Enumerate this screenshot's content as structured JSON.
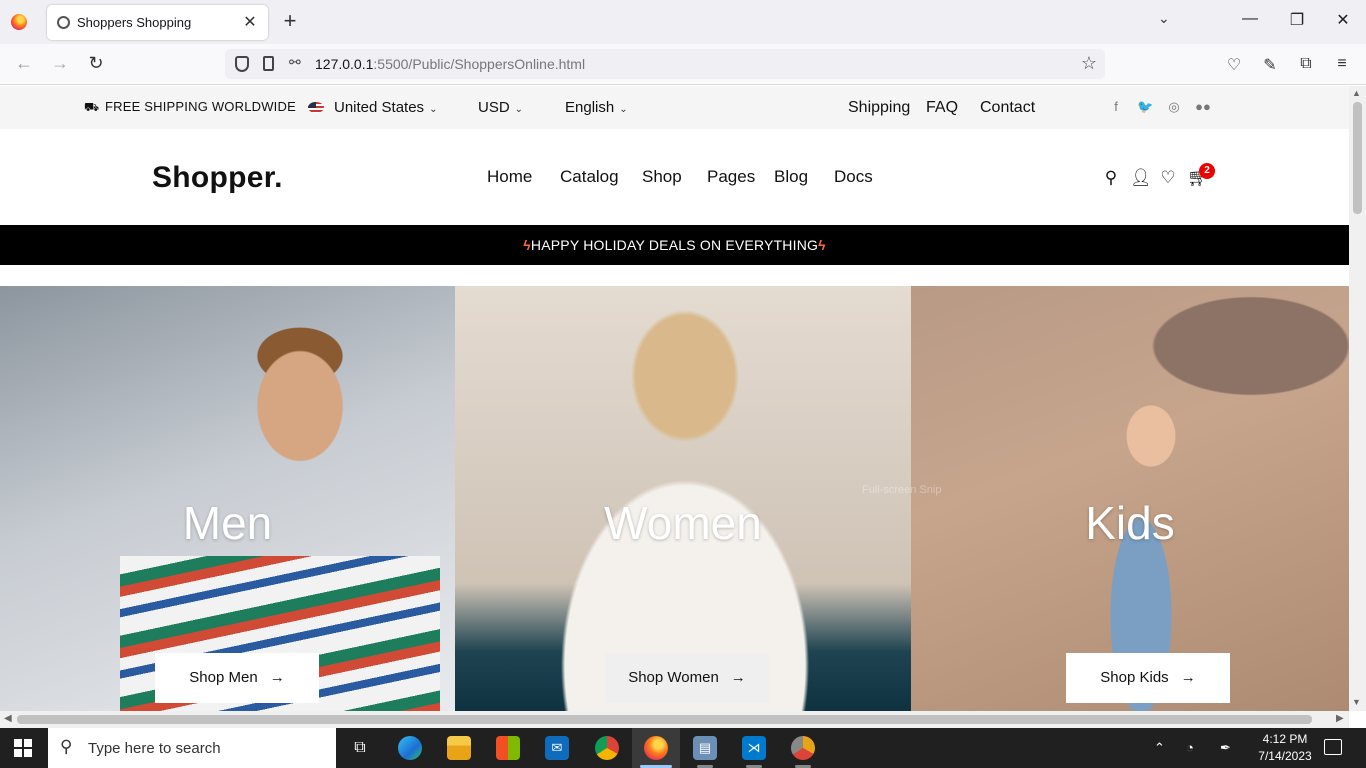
{
  "browser": {
    "tab_title": "Shoppers Shopping",
    "url_host": "127.0.0.1",
    "url_rest": ":5500/Public/ShoppersOnline.html"
  },
  "topbar": {
    "shipping": "FREE SHIPPING WORLDWIDE",
    "country": "United States",
    "currency": "USD",
    "language": "English",
    "links": [
      "Shipping",
      "FAQ",
      "Contact"
    ],
    "social_icons": [
      "facebook-icon",
      "twitter-icon",
      "instagram-icon",
      "medium-icon"
    ]
  },
  "header": {
    "logo": "Shopper.",
    "nav": [
      "Home",
      "Catalog",
      "Shop",
      "Pages",
      "Blog",
      "Docs"
    ],
    "cart_count": "2",
    "icons": [
      "search-icon",
      "user-icon",
      "heart-icon",
      "cart-icon"
    ]
  },
  "promo": {
    "text": "HAPPY HOLIDAY DEALS ON EVERYTHING"
  },
  "categories": [
    {
      "title": "Men",
      "button": "Shop Men"
    },
    {
      "title": "Women",
      "button": "Shop Women"
    },
    {
      "title": "Kids",
      "button": "Shop Kids"
    }
  ],
  "overlay_text": "Full-screen Snip",
  "taskbar": {
    "search_placeholder": "Type here to search",
    "time": "4:12 PM",
    "date": "7/14/2023",
    "apps": [
      "task-view-icon",
      "edge-icon",
      "file-explorer-icon",
      "store-icon",
      "mail-icon",
      "chrome-icon",
      "firefox-icon",
      "remote-desktop-icon",
      "vscode-icon",
      "chrome-canary-icon"
    ]
  },
  "colors": {
    "promo_bg": "#000000",
    "bolt": "#ff6a3d",
    "badge": "#e00000",
    "topbar_bg": "#f5f5f5"
  }
}
